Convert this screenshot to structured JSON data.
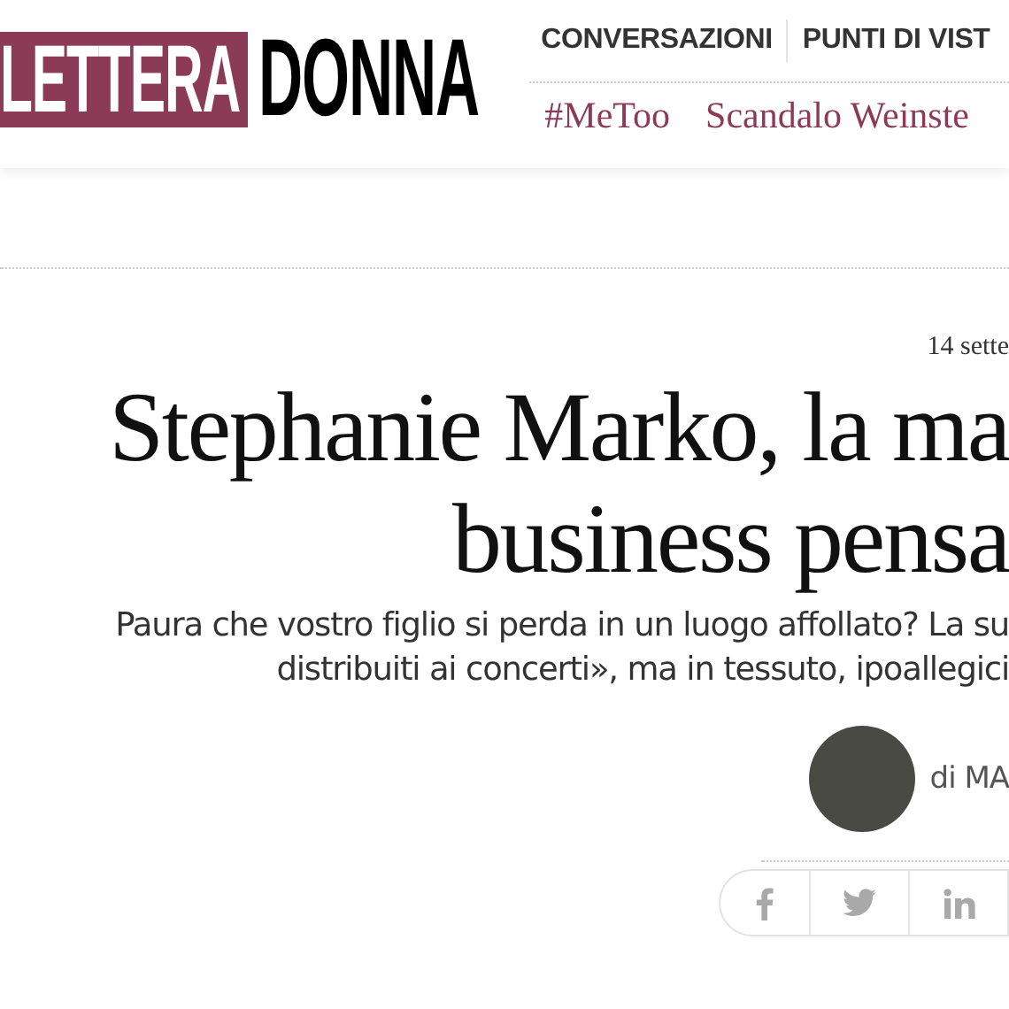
{
  "logo": {
    "part_1": "LETTERA",
    "part_2": "DONNA"
  },
  "nav": {
    "sections": [
      {
        "label": "CONVERSAZIONI"
      },
      {
        "label": "PUNTI DI VIST"
      }
    ],
    "tags": [
      {
        "label": "#MeToo"
      },
      {
        "label": "Scandalo Weinste"
      }
    ]
  },
  "article": {
    "date": "14 sette",
    "title_lines": [
      "Stephanie Marko, la ma",
      "business pensa"
    ],
    "subtitle_lines": [
      "Paura che vostro figlio si perda in un luogo affollato? La su",
      "distribuiti ai concerti», ma in tessuto, ipoallegici"
    ],
    "author": "di MA",
    "share": [
      {
        "kind": "facebook"
      },
      {
        "kind": "twitter"
      },
      {
        "kind": "linkedin"
      }
    ]
  }
}
